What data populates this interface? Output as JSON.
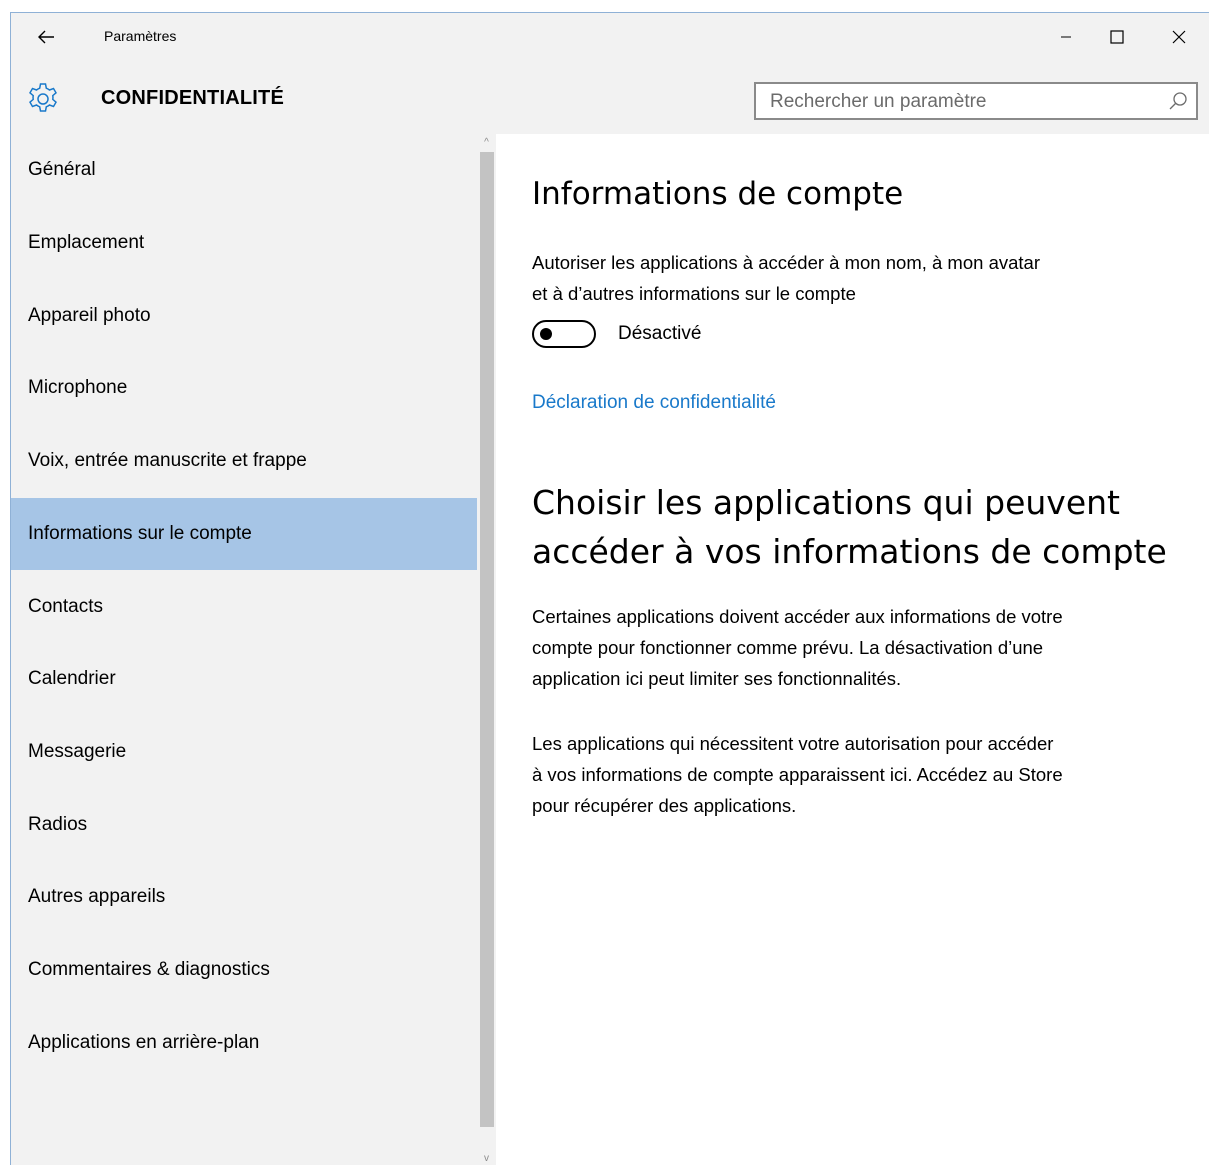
{
  "window": {
    "title": "Paramètres",
    "back_icon": "back-arrow-icon",
    "controls": {
      "minimize_glyph": "–",
      "maximize_glyph": "☐",
      "close_glyph": "✕"
    }
  },
  "header": {
    "icon": "gear-icon",
    "title": "CONFIDENTIALITÉ",
    "search_placeholder": "Rechercher un paramètre",
    "search_icon": "search-icon"
  },
  "sidebar": {
    "items": [
      {
        "label": "Général"
      },
      {
        "label": "Emplacement"
      },
      {
        "label": "Appareil photo"
      },
      {
        "label": "Microphone"
      },
      {
        "label": "Voix, entrée manuscrite et frappe"
      },
      {
        "label": "Informations sur le compte",
        "selected": true
      },
      {
        "label": "Contacts"
      },
      {
        "label": "Calendrier"
      },
      {
        "label": "Messagerie"
      },
      {
        "label": "Radios"
      },
      {
        "label": "Autres appareils"
      },
      {
        "label": "Commentaires & diagnostics"
      },
      {
        "label": "Applications en arrière-plan"
      }
    ],
    "scroll_up_glyph": "^",
    "scroll_down_glyph": "v"
  },
  "main": {
    "section1_title": "Informations de compte",
    "section1_desc_line1": "Autoriser les applications à accéder à mon nom, à mon avatar",
    "section1_desc_line2": "et à d’autres informations sur le compte",
    "toggle_state": "Désactivé",
    "privacy_link": "Déclaration de confidentialité",
    "section2_title_line1": "Choisir les applications qui peuvent",
    "section2_title_line2": "accéder à vos informations de compte",
    "para1_line1": "Certaines applications doivent accéder aux informations de votre",
    "para1_line2": "compte pour fonctionner comme prévu. La désactivation d’une",
    "para1_line3": "application ici peut limiter ses fonctionnalités.",
    "para2_line1": "Les applications qui nécessitent votre autorisation pour accéder",
    "para2_line2": "à vos informations de compte apparaissent ici. Accédez au Store",
    "para2_line3": "pour récupérer des applications."
  },
  "colors": {
    "accent_link": "#1979ca",
    "selected_item": "#a6c5e6",
    "chrome_bg": "#f2f2f2"
  }
}
